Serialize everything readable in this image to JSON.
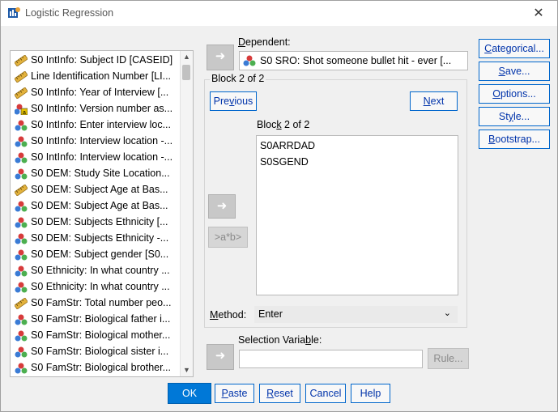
{
  "window": {
    "title": "Logistic Regression",
    "close_glyph": "✕"
  },
  "variables": [
    {
      "label": "S0 IntInfo: Subject ID [CASEID]",
      "icon": "ruler-icon"
    },
    {
      "label": "Line Identification Number [LI...",
      "icon": "ruler-icon"
    },
    {
      "label": "S0 IntInfo: Year of Interview [...",
      "icon": "ruler-icon"
    },
    {
      "label": "S0 IntInfo: Version number as...",
      "icon": "nominal-string-icon"
    },
    {
      "label": "S0 IntInfo: Enter interview loc...",
      "icon": "nominal-icon"
    },
    {
      "label": "S0 IntInfo: Interview location -...",
      "icon": "nominal-icon"
    },
    {
      "label": "S0 IntInfo: Interview location -...",
      "icon": "nominal-icon"
    },
    {
      "label": "S0 DEM: Study Site Location...",
      "icon": "nominal-icon"
    },
    {
      "label": "S0 DEM: Subject Age at Bas...",
      "icon": "ruler-icon"
    },
    {
      "label": "S0 DEM: Subject Age at Bas...",
      "icon": "nominal-icon"
    },
    {
      "label": "S0 DEM: Subjects Ethnicity [...",
      "icon": "nominal-icon"
    },
    {
      "label": "S0 DEM: Subjects Ethnicity -...",
      "icon": "nominal-icon"
    },
    {
      "label": "S0 DEM: Subject gender [S0...",
      "icon": "nominal-icon"
    },
    {
      "label": "S0 Ethnicity: In what country ...",
      "icon": "nominal-icon"
    },
    {
      "label": "S0 Ethnicity: In what country ...",
      "icon": "nominal-icon"
    },
    {
      "label": "S0 FamStr: Total number peo...",
      "icon": "ruler-icon"
    },
    {
      "label": "S0 FamStr: Biological father i...",
      "icon": "nominal-icon"
    },
    {
      "label": "S0 FamStr: Biological mother...",
      "icon": "nominal-icon"
    },
    {
      "label": "S0 FamStr: Biological sister i...",
      "icon": "nominal-icon"
    },
    {
      "label": "S0 FamStr: Biological brother...",
      "icon": "nominal-icon"
    }
  ],
  "dependent": {
    "label_pre": "",
    "label_mn": "D",
    "label_post": "ependent:",
    "value": "S0 SRO: Shot someone bullet hit - ever [..."
  },
  "block": {
    "group_title": "Block 2 of 2",
    "inner_title_pre": "Bloc",
    "inner_title_mn": "k",
    "inner_title_post": " 2 of 2",
    "previous_pre": "Pre",
    "previous_mn": "v",
    "previous_post": "ious",
    "next_pre": "",
    "next_mn": "N",
    "next_post": "ext",
    "items": [
      "S0ARRDAD",
      "S0SGEND"
    ],
    "interaction_label": ">a*b>"
  },
  "method": {
    "label_pre": "",
    "label_mn": "M",
    "label_post": "ethod:",
    "value": "Enter"
  },
  "selection": {
    "label_pre": "Selection Varia",
    "label_mn": "b",
    "label_post": "le:",
    "value": "",
    "rule_label": "Rule..."
  },
  "side_buttons": [
    {
      "pre": "",
      "mn": "C",
      "post": "ategorical..."
    },
    {
      "pre": "",
      "mn": "S",
      "post": "ave..."
    },
    {
      "pre": "",
      "mn": "O",
      "post": "ptions..."
    },
    {
      "pre": "St",
      "mn": "y",
      "post": "le..."
    },
    {
      "pre": "",
      "mn": "B",
      "post": "ootstrap..."
    }
  ],
  "bottom_buttons": {
    "ok": "OK",
    "paste": {
      "pre": "",
      "mn": "P",
      "post": "aste"
    },
    "reset": {
      "pre": "",
      "mn": "R",
      "post": "eset"
    },
    "cancel": "Cancel",
    "help": "Help"
  },
  "colors": {
    "accent": "#0078d7",
    "link_text": "#0033aa",
    "arrow_disabled": "#c8c8c8"
  }
}
